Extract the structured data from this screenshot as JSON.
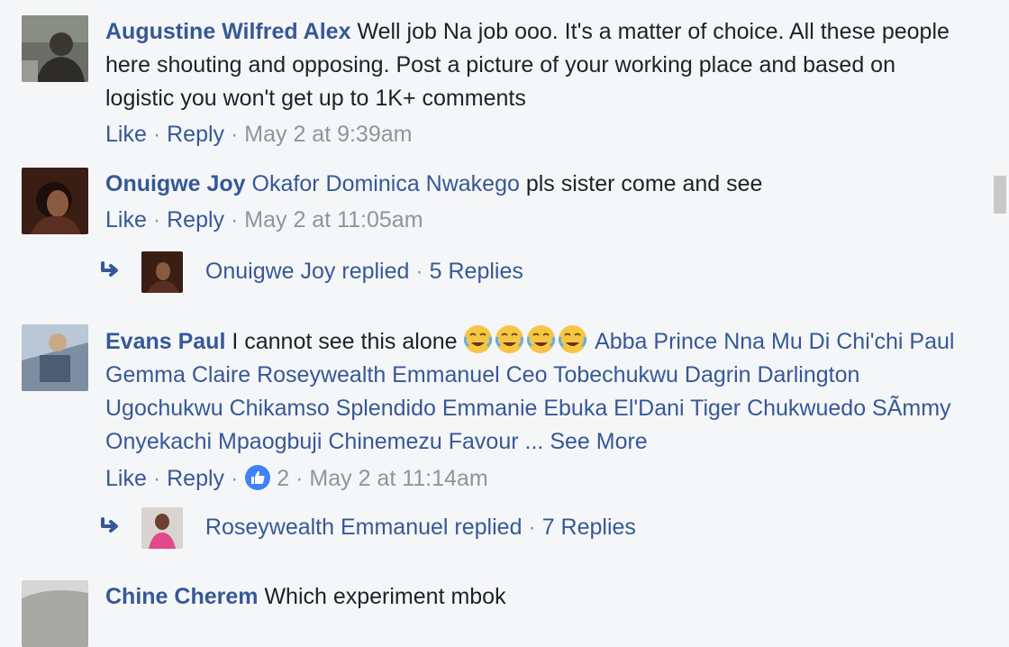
{
  "comments": [
    {
      "author": "Augustine Wilfred Alex",
      "text": "Well job Na job ooo. It's a matter of choice. All these people here shouting and opposing. Post a picture of your working place and based on logistic you won't get up to 1K+ comments",
      "like": "Like",
      "reply": "Reply",
      "time": "May 2 at 9:39am"
    },
    {
      "author": "Onuigwe Joy",
      "tag": "Okafor Dominica Nwakego",
      "text": "pls sister come and see",
      "like": "Like",
      "reply": "Reply",
      "time": "May 2 at 11:05am",
      "replies_summary": {
        "replier": "Onuigwe Joy replied",
        "count": "5 Replies"
      }
    },
    {
      "author": "Evans Paul",
      "text": "I cannot see this alone",
      "emoji": [
        "face-with-tears-of-joy",
        "face-with-tears-of-joy",
        "face-with-tears-of-joy",
        "face-with-tears-of-joy"
      ],
      "tags_line": "Abba Prince Nna Mu Di Chi'chi Paul Gemma Claire Roseywealth Emmanuel Ceo Tobechukwu Dagrin Darlington Ugochukwu Chikamso Splendido Emmanie Ebuka El'Dani Tiger Chukwuedo SÃmmy Onyekachi Mpaogbuji Chinemezu Favour ...",
      "see_more": "See More",
      "like": "Like",
      "reply": "Reply",
      "reactions": "2",
      "time": "May 2 at 11:14am",
      "replies_summary": {
        "replier": "Roseywealth Emmanuel replied",
        "count": "7 Replies"
      }
    },
    {
      "author": "Chine Cherem",
      "text": "Which experiment mbok"
    }
  ],
  "colors": {
    "link": "#365899",
    "meta": "#90949c",
    "background": "#f5f6f7",
    "like_badge": "#4080ff"
  }
}
